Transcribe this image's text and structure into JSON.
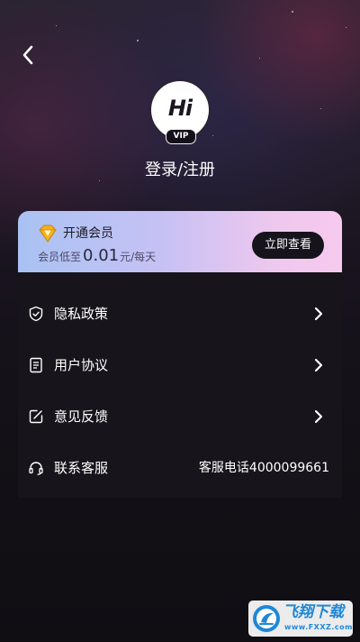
{
  "header": {
    "back_icon": "chevron-left-icon"
  },
  "profile": {
    "avatar_text": "Hi",
    "vip_badge": "VIP",
    "login_label": "登录/注册"
  },
  "vip_card": {
    "icon": "diamond-icon",
    "title": "开通会员",
    "price_prefix": "会员低至",
    "price_amount": "0.01",
    "price_suffix": "元/每天",
    "button_label": "立即查看",
    "colors": {
      "gradient_start": "#a9c2f3",
      "gradient_end": "#f7c9ef",
      "button_bg": "#17131c"
    }
  },
  "menu": {
    "items": [
      {
        "label": "隐私政策",
        "icon": "shield-icon",
        "action": "chevron-right-icon"
      },
      {
        "label": "用户协议",
        "icon": "document-icon",
        "action": "chevron-right-icon"
      },
      {
        "label": "意见反馈",
        "icon": "edit-feedback-icon",
        "action": "chevron-right-icon"
      },
      {
        "label": "联系客服",
        "icon": "headset-icon",
        "value": "客服电话4000099661"
      }
    ]
  },
  "watermark": {
    "text": "飞翔下载",
    "url": "www.FXXZ.com"
  }
}
